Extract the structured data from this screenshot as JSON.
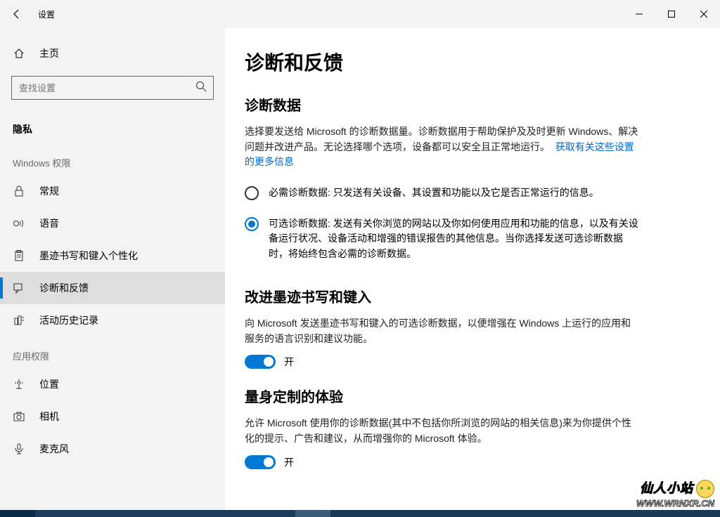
{
  "window": {
    "title": "设置"
  },
  "sidebar": {
    "home": "主页",
    "search_placeholder": "查找设置",
    "category": "隐私",
    "group1": "Windows 权限",
    "items1": [
      {
        "label": "常规"
      },
      {
        "label": "语音"
      },
      {
        "label": "墨迹书写和键入个性化"
      },
      {
        "label": "诊断和反馈"
      },
      {
        "label": "活动历史记录"
      }
    ],
    "group2": "应用权限",
    "items2": [
      {
        "label": "位置"
      },
      {
        "label": "相机"
      },
      {
        "label": "麦克风"
      }
    ]
  },
  "main": {
    "title": "诊断和反馈",
    "sec1": {
      "heading": "诊断数据",
      "para": "选择要发送给 Microsoft 的诊断数据量。诊断数据用于帮助保护及及时更新 Windows、解决问题并改进产品。无论选择哪个选项，设备都可以安全且正常地运行。",
      "link": "获取有关这些设置的更多信息",
      "radio1_label": "必需诊断数据:",
      "radio1_text": " 只发送有关设备、其设置和功能以及它是否正常运行的信息。",
      "radio2_label": "可选诊断数据:",
      "radio2_text": " 发送有关你浏览的网站以及你如何使用应用和功能的信息，以及有关设备运行状况、设备活动和增强的错误报告的其他信息。当你选择发送可选诊断数据时，将始终包含必需的诊断数据。"
    },
    "sec2": {
      "heading": "改进墨迹书写和键入",
      "para": "向 Microsoft 发送墨迹书写和键入的可选诊断数据，以便增强在 Windows 上运行的应用和服务的语言识别和建议功能。",
      "toggle": "开"
    },
    "sec3": {
      "heading": "量身定制的体验",
      "para": "允许 Microsoft 使用你的诊断数据(其中不包括你所浏览的网站的相关信息)来为你提供个性化的提示、广告和建议，从而增强你的 Microsoft 体验。",
      "toggle": "开"
    }
  },
  "watermark": {
    "line1": "仙人小站",
    "line2": "WWW.WRNXR.CN"
  }
}
